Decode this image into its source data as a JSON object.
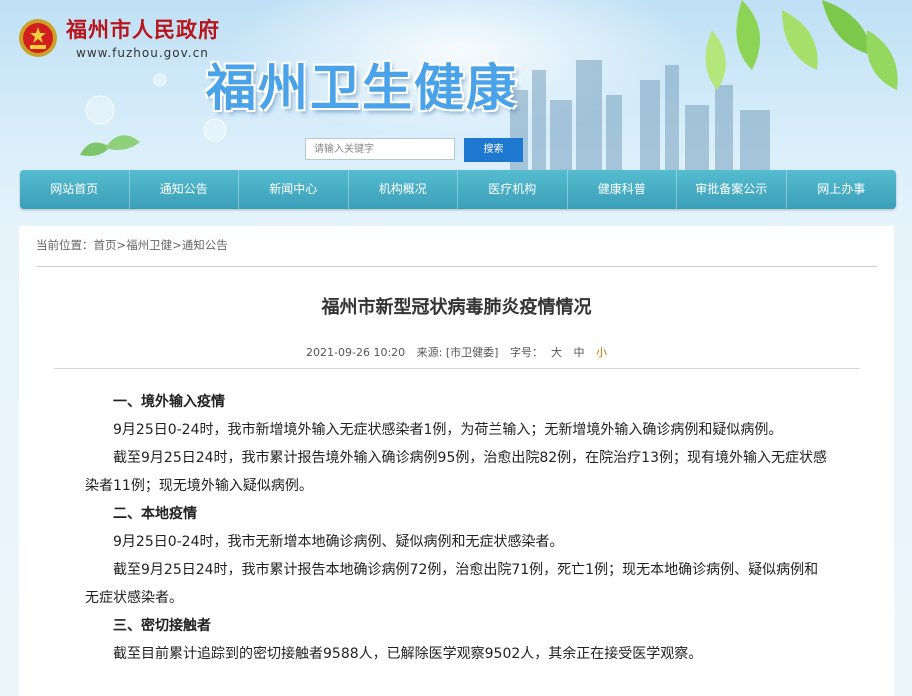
{
  "header": {
    "gov_name": "福州市人民政府",
    "gov_url": "www.fuzhou.gov.cn",
    "site_title": "福州卫生健康",
    "search_placeholder": "请输入关键字",
    "search_button": "搜索"
  },
  "nav": {
    "items": [
      "网站首页",
      "通知公告",
      "新闻中心",
      "机构概况",
      "医疗机构",
      "健康科普",
      "审批备案公示",
      "网上办事"
    ]
  },
  "breadcrumb": {
    "prefix": "当前位置：",
    "home": "首页",
    "sep1": ">",
    "section": "福州卫健",
    "sep2": ">",
    "current": "通知公告"
  },
  "article": {
    "title": "福州市新型冠状病毒肺炎疫情情况",
    "date": "2021-09-26 10:20",
    "source": "来源: [市卫健委]",
    "font_size_label": "字号：",
    "font_large": "大",
    "font_medium": "中",
    "font_small": "小",
    "paragraphs": [
      "一、境外输入疫情",
      "9月25日0-24时，我市新增境外输入无症状感染者1例，为荷兰输入；无新增境外输入确诊病例和疑似病例。",
      "截至9月25日24时，我市累计报告境外输入确诊病例95例，治愈出院82例，在院治疗13例；现有境外输入无症状感染者11例；现无境外输入疑似病例。",
      "二、本地疫情",
      "9月25日0-24时，我市无新增本地确诊病例、疑似病例和无症状感染者。",
      "截至9月25日24时，我市累计报告本地确诊病例72例，治愈出院71例，死亡1例；现无本地确诊病例、疑似病例和无症状感染者。",
      "三、密切接触者",
      "截至目前累计追踪到的密切接触者9588人，已解除医学观察9502人，其余正在接受医学观察。"
    ]
  },
  "colors": {
    "nav_bg": "#45aac2",
    "gov_red": "#b8141a",
    "title_blue": "#4aa3e8",
    "search_btn": "#1f78d0",
    "small_font_highlight": "#d47500"
  }
}
